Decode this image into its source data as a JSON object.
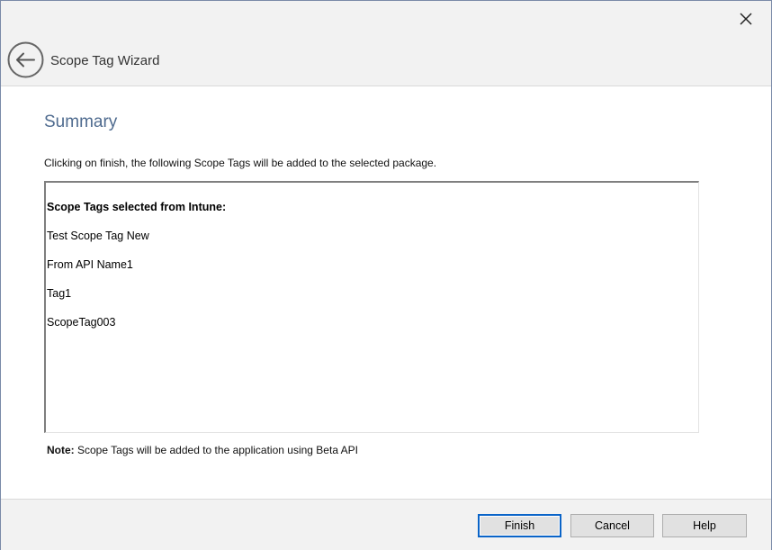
{
  "window": {
    "title": "Scope Tag Wizard"
  },
  "page": {
    "heading": "Summary",
    "description": "Clicking on finish, the following Scope Tags will be added to the selected package."
  },
  "summary": {
    "header": "Scope Tags selected from Intune:",
    "tags": [
      "Test Scope Tag New",
      "From API Name1",
      "Tag1",
      "ScopeTag003"
    ]
  },
  "note": {
    "label": "Note:",
    "text": " Scope Tags will be added to the application using Beta API"
  },
  "buttons": {
    "finish": "Finish",
    "cancel": "Cancel",
    "help": "Help"
  },
  "icons": {
    "close": "close-icon",
    "back": "back-arrow-icon"
  },
  "colors": {
    "heading": "#4f6b8f",
    "accent": "#0a64c8"
  }
}
